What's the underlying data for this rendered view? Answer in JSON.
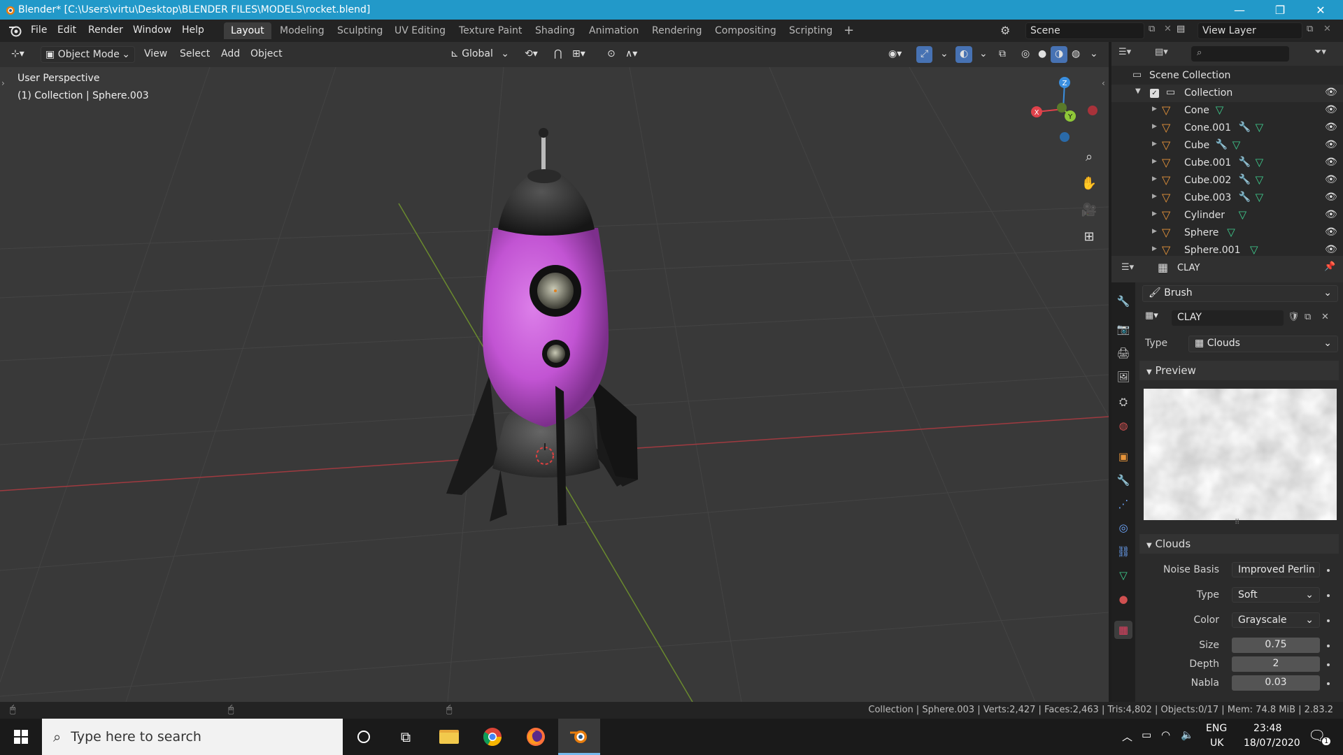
{
  "title_bar": {
    "title": "Blender* [C:\\Users\\virtu\\Desktop\\BLENDER FILES\\MODELS\\rocket.blend]",
    "minimize": "—",
    "maximize": "❐",
    "close": "✕"
  },
  "menu": {
    "items": [
      "File",
      "Edit",
      "Render",
      "Window",
      "Help"
    ]
  },
  "workspaces": {
    "tabs": [
      "Layout",
      "Modeling",
      "Sculpting",
      "UV Editing",
      "Texture Paint",
      "Shading",
      "Animation",
      "Rendering",
      "Compositing",
      "Scripting"
    ],
    "active": "Layout",
    "add": "+"
  },
  "scene_selector": {
    "value": "Scene"
  },
  "view_layer_selector": {
    "value": "View Layer"
  },
  "viewport_header": {
    "mode": "Object Mode",
    "menus": [
      "View",
      "Select",
      "Add",
      "Object"
    ],
    "transform_orientation": "Global"
  },
  "viewport": {
    "perspective_label": "User Perspective",
    "collection_label": "(1) Collection | Sphere.003",
    "gizmo": {
      "x": "X",
      "y": "Y",
      "z": "Z"
    }
  },
  "outliner": {
    "root": "Scene Collection",
    "collection": "Collection",
    "objects": [
      {
        "name": "Cone",
        "modifier": false
      },
      {
        "name": "Cone.001",
        "modifier": true
      },
      {
        "name": "Cube",
        "modifier": true
      },
      {
        "name": "Cube.001",
        "modifier": true
      },
      {
        "name": "Cube.002",
        "modifier": true
      },
      {
        "name": "Cube.003",
        "modifier": true
      },
      {
        "name": "Cylinder",
        "modifier": false
      },
      {
        "name": "Sphere",
        "modifier": false
      },
      {
        "name": "Sphere.001",
        "modifier": false
      }
    ]
  },
  "properties": {
    "header_title": "CLAY",
    "context": "Brush",
    "texture_name": "CLAY",
    "type_label": "Type",
    "type_value": "Clouds",
    "preview_panel": "Preview",
    "clouds_panel": "Clouds",
    "noise_basis_label": "Noise Basis",
    "noise_basis_value": "Improved Perlin",
    "clouds_type_label": "Type",
    "clouds_type_value": "Soft",
    "color_label": "Color",
    "color_value": "Grayscale",
    "size_label": "Size",
    "size_value": "0.75",
    "depth_label": "Depth",
    "depth_value": "2",
    "nabla_label": "Nabla",
    "nabla_value": "0.03"
  },
  "status_bar": {
    "stats": "Collection | Sphere.003 | Verts:2,427 | Faces:2,463 | Tris:4,802 | Objects:0/17 | Mem: 74.8 MiB | 2.83.2"
  },
  "taskbar": {
    "search_placeholder": "Type here to search",
    "language": "ENG",
    "region": "UK",
    "time": "23:48",
    "date": "18/07/2020",
    "notification_count": "1"
  },
  "colors": {
    "accent": "#2299c9",
    "rocket_body": "#c254d3",
    "object_icon": "#e8953a",
    "mesh_icon": "#3fce8f",
    "modifier_icon": "#6fa8ff",
    "axis_x": "#e0424b",
    "axis_y": "#8fc838",
    "axis_z": "#3a8fe0"
  }
}
